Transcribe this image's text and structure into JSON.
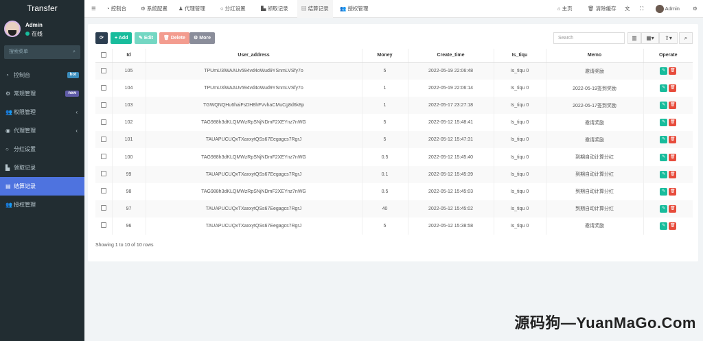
{
  "app_title": "Transfer",
  "user": {
    "name": "Admin",
    "status": "在线"
  },
  "sidebar": {
    "search_placeholder": "搜索菜单",
    "items": [
      {
        "label": "控制台",
        "icon": "dashboard-icon",
        "badge": "hot",
        "badge_color": "#3c8dbc"
      },
      {
        "label": "常规管理",
        "icon": "cogs-icon",
        "badge": "new",
        "badge_color": "#605ca8"
      },
      {
        "label": "权限管理",
        "icon": "group-icon",
        "arrow": "‹"
      },
      {
        "label": "代理管理",
        "icon": "user-circle-icon",
        "arrow": "‹"
      },
      {
        "label": "分红设置",
        "icon": "circle-icon"
      },
      {
        "label": "领取记录",
        "icon": "industry-icon"
      },
      {
        "label": "结算记录",
        "icon": "list-alt-icon",
        "active": true
      },
      {
        "label": "授权管理",
        "icon": "group-icon"
      }
    ]
  },
  "topnav": {
    "tabs": [
      "控制台",
      "系统配置",
      "代理管理",
      "分红设置",
      "领取记录",
      "结算记录",
      "授权管理"
    ],
    "home": "主页",
    "clear_cache": "清除缓存",
    "admin": "Admin"
  },
  "toolbar": {
    "add": "Add",
    "edit": "Edit",
    "delete": "Delete",
    "more": "More",
    "search_placeholder": "Search"
  },
  "table": {
    "headers": [
      "Id",
      "User_address",
      "Money",
      "Create_time",
      "Is_tiqu",
      "Memo",
      "Operate"
    ],
    "rows": [
      [
        "105",
        "TPUmU3iWAAUv594vd4oWud9YSnmLVSfy7o",
        "5",
        "2022-05-19 22:06:48",
        "Is_tiqu 0",
        "邀请奖励"
      ],
      [
        "104",
        "TPUmU3iWAAUv594vd4oWud9YSnmLVSfy7o",
        "1",
        "2022-05-19 22:06:14",
        "Is_tiqu 0",
        "2022-05-19签到奖励"
      ],
      [
        "103",
        "TGWQNQHu6haiFsDH8hFVvhaCMuCg8d6k8p",
        "1",
        "2022-05-17 23:27:18",
        "Is_tiqu 0",
        "2022-05-17签到奖励"
      ],
      [
        "102",
        "TAG988h3dKLQMWzRpSNjNDmF2XEYnz7nWG",
        "5",
        "2022-05-12 15:48:41",
        "Is_tiqu 0",
        "邀请奖励"
      ],
      [
        "101",
        "TAUAPUCUQxTXaxxytQSs67Eegagcs7RgrJ",
        "5",
        "2022-05-12 15:47:31",
        "Is_tiqu 0",
        "邀请奖励"
      ],
      [
        "100",
        "TAG988h3dKLQMWzRpSNjNDmF2XEYnz7nWG",
        "0.5",
        "2022-05-12 15:45:40",
        "Is_tiqu 0",
        "到期自动计算分红"
      ],
      [
        "99",
        "TAUAPUCUQxTXaxxytQSs67Eegagcs7RgrJ",
        "0.1",
        "2022-05-12 15:45:39",
        "Is_tiqu 0",
        "到期自动计算分红"
      ],
      [
        "98",
        "TAG988h3dKLQMWzRpSNjNDmF2XEYnz7nWG",
        "0.5",
        "2022-05-12 15:45:03",
        "Is_tiqu 0",
        "到期自动计算分红"
      ],
      [
        "97",
        "TAUAPUCUQxTXaxxytQSs67Eegagcs7RgrJ",
        "40",
        "2022-05-12 15:45:02",
        "Is_tiqu 0",
        "到期自动计算分红"
      ],
      [
        "96",
        "TAUAPUCUQxTXaxxytQSs67Eegagcs7RgrJ",
        "5",
        "2022-05-12 15:38:58",
        "Is_tiqu 0",
        "邀请奖励"
      ]
    ],
    "footer": "Showing 1 to 10 of 10 rows"
  },
  "watermark": "源码狗—YuanMaGo.Com"
}
